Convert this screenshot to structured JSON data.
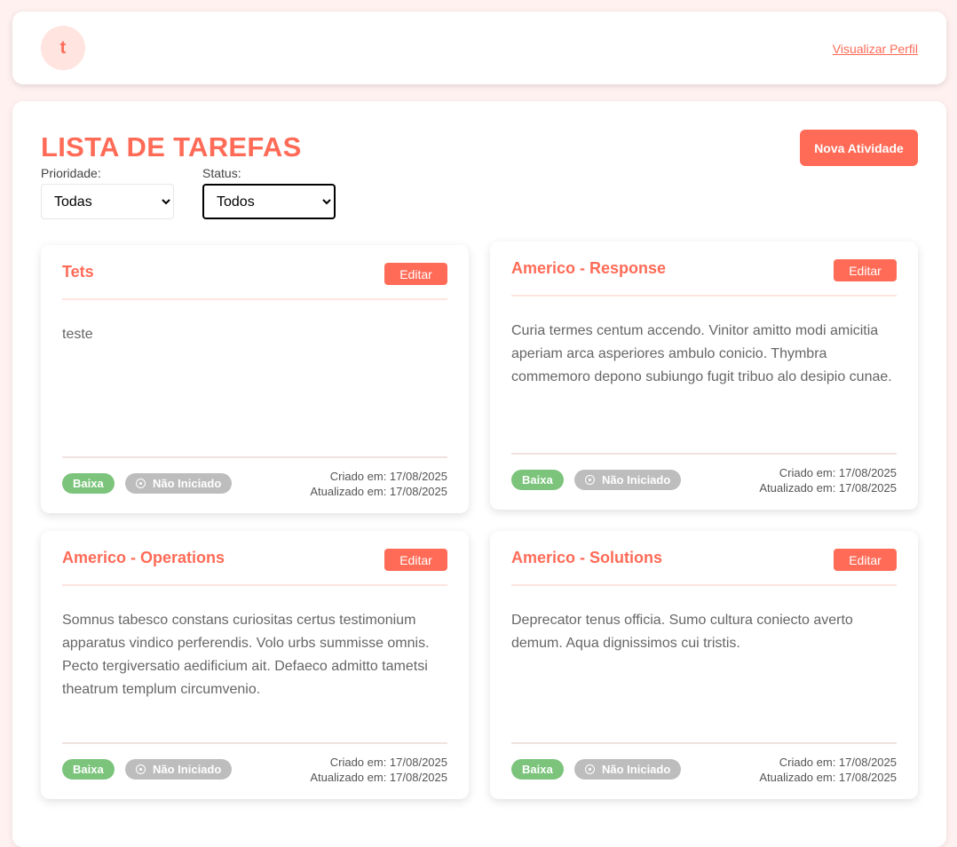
{
  "header": {
    "avatar_letter": "t",
    "profile_link": "Visualizar Perfil"
  },
  "main": {
    "title": "LISTA DE TAREFAS",
    "new_button": "Nova Atividade",
    "filters": {
      "priority_label": "Prioridade:",
      "priority_value": "Todas",
      "status_label": "Status:",
      "status_value": "Todos"
    }
  },
  "colors": {
    "accent": "#ff6b57",
    "priority_low": "#7cc47c",
    "status_not_started": "#bdbdbd",
    "background": "#fff1ef"
  },
  "tasks": [
    {
      "title": "Tets",
      "edit_label": "Editar",
      "description": "teste",
      "priority": "Baixa",
      "status": "Não Iniciado",
      "created": "Criado em: 17/08/2025",
      "updated": "Atualizado em: 17/08/2025"
    },
    {
      "title": "Americo - Response",
      "edit_label": "Editar",
      "description": "Curia termes centum accendo. Vinitor amitto modi amicitia aperiam arca asperiores ambulo conicio. Thymbra commemoro depono subiungo fugit tribuo alo desipio cunae.",
      "priority": "Baixa",
      "status": "Não Iniciado",
      "created": "Criado em: 17/08/2025",
      "updated": "Atualizado em: 17/08/2025"
    },
    {
      "title": "Americo - Operations",
      "edit_label": "Editar",
      "description": "Somnus tabesco constans curiositas certus testimonium apparatus vindico perferendis. Volo urbs summisse omnis. Pecto tergiversatio aedificium ait. Defaeco admitto tametsi theatrum templum circumvenio.",
      "priority": "Baixa",
      "status": "Não Iniciado",
      "created": "Criado em: 17/08/2025",
      "updated": "Atualizado em: 17/08/2025"
    },
    {
      "title": "Americo - Solutions",
      "edit_label": "Editar",
      "description": "Deprecator tenus officia. Sumo cultura coniecto averto demum. Aqua dignissimos cui tristis.",
      "priority": "Baixa",
      "status": "Não Iniciado",
      "created": "Criado em: 17/08/2025",
      "updated": "Atualizado em: 17/08/2025"
    }
  ]
}
